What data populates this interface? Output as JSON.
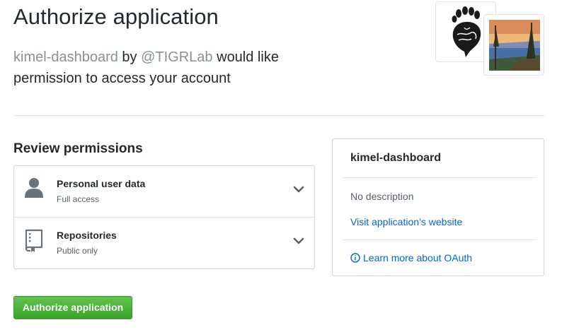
{
  "page": {
    "title": "Authorize application",
    "lead": {
      "app_name": "kimel-dashboard",
      "by": " by ",
      "owner": "@TIGRLab",
      "rest": " would like permission to access your account"
    }
  },
  "review": {
    "heading": "Review permissions",
    "permissions": [
      {
        "name": "Personal user data",
        "access": "Full access",
        "icon": "person-icon"
      },
      {
        "name": "Repositories",
        "access": "Public only",
        "icon": "repo-icon"
      }
    ]
  },
  "sidebar": {
    "app_name": "kimel-dashboard",
    "description": "No description",
    "website_link": "Visit application’s website",
    "oauth_link": "Learn more about OAuth"
  },
  "actions": {
    "authorize_label": "Authorize application"
  },
  "colors": {
    "primary_button": "#3aa22a",
    "link": "#0366d6",
    "muted": "#8a8f95"
  }
}
